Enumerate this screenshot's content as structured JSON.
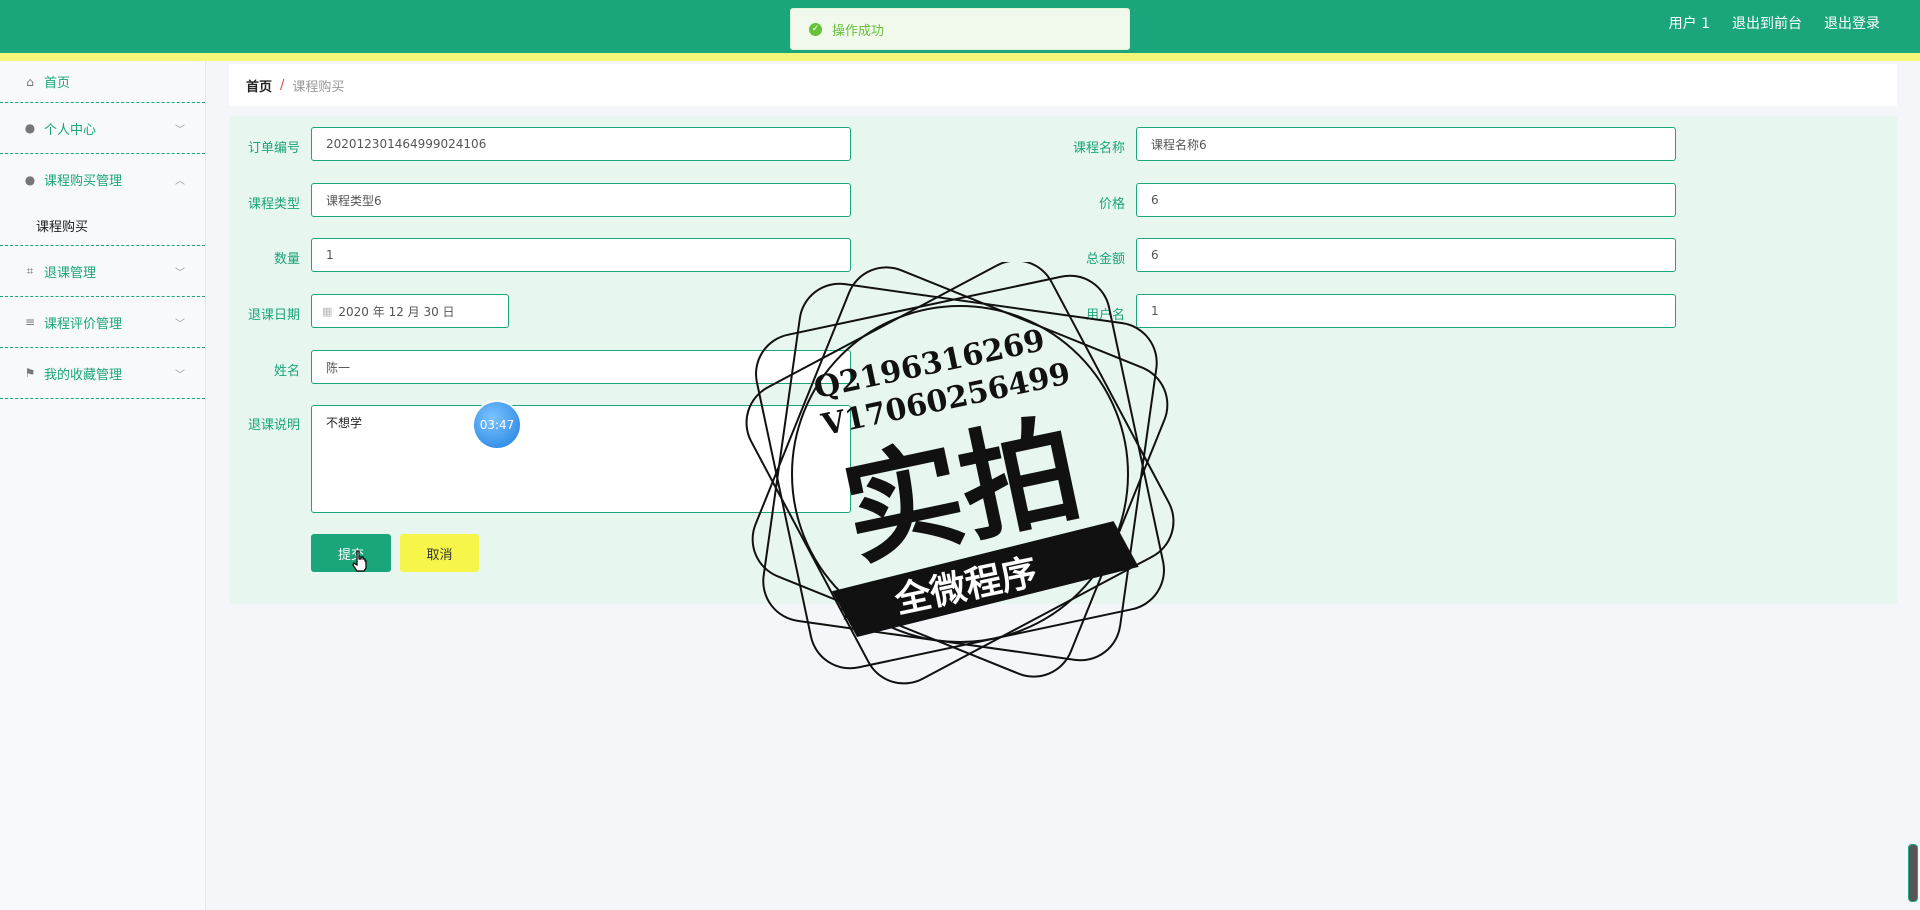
{
  "header": {
    "links": {
      "user": "用户 1",
      "frontend": "退出到前台",
      "logout": "退出登录"
    },
    "toast": "操作成功"
  },
  "sidebar": {
    "items": [
      {
        "label": "首页",
        "icon": "home-icon"
      },
      {
        "label": "个人中心",
        "icon": "user-icon"
      },
      {
        "label": "课程购买管理",
        "icon": "user-icon",
        "children": [
          "课程购买"
        ]
      },
      {
        "label": "退课管理",
        "icon": "crop-icon"
      },
      {
        "label": "课程评价管理",
        "icon": "list-icon"
      },
      {
        "label": "我的收藏管理",
        "icon": "flag-icon"
      }
    ]
  },
  "breadcrumb": {
    "home": "首页",
    "separator": "/",
    "current": "课程购买"
  },
  "form": {
    "order_no": {
      "label": "订单编号",
      "value": "202012301464999024106"
    },
    "course_name": {
      "label": "课程名称",
      "value": "课程名称6"
    },
    "course_type": {
      "label": "课程类型",
      "value": "课程类型6"
    },
    "price": {
      "label": "价格",
      "value": "6"
    },
    "quantity": {
      "label": "数量",
      "value": "1"
    },
    "total": {
      "label": "总金额",
      "value": "6"
    },
    "drop_date": {
      "label": "退课日期",
      "value": "2020 年 12 月 30 日"
    },
    "username": {
      "label": "用户名",
      "value": "1"
    },
    "name": {
      "label": "姓名",
      "value": "陈一"
    },
    "reason": {
      "label": "退课说明",
      "value": "不想学"
    },
    "submit": "提交",
    "cancel": "取消"
  },
  "overlay": {
    "timer": "03:47",
    "watermark": {
      "line1": "Q2196316269",
      "line2": "V17060256499",
      "big": "实拍",
      "banner": "全微程序"
    }
  },
  "colors": {
    "accent": "#1aa57a",
    "stripe": "#f5f57a",
    "cancel": "#f5f54a",
    "panel": "#e8f6f0"
  }
}
